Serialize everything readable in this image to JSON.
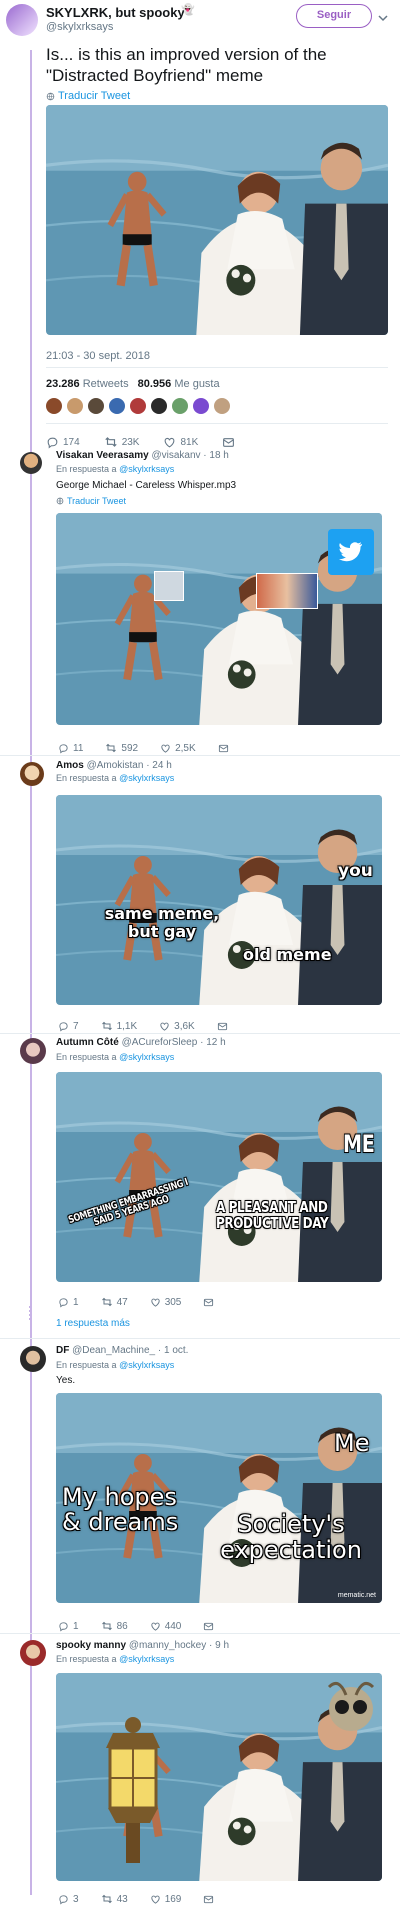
{
  "main_tweet": {
    "name": "SKYLXRK, but spooky",
    "handle": "@skylxrksays",
    "follow_label": "Seguir",
    "text": "Is... is this an improved version of the \"Distracted Boyfriend\" meme",
    "translate": "Traducir Tweet",
    "timestamp": "21:03 - 30 sept. 2018",
    "retweets": "23.286",
    "retweets_label": "Retweets",
    "likes": "80.956",
    "likes_label": "Me gusta",
    "replies_count": "174",
    "rt_count": "23K",
    "like_count": "81K"
  },
  "replies": [
    {
      "name": "Visakan Veerasamy",
      "handle": "@visakanv · 18 h",
      "reply_prefix": "En respuesta a",
      "reply_to": "@skylxrksays",
      "text": "George Michael - Careless Whisper.mp3",
      "translate": "Traducir Tweet",
      "counts": [
        "11",
        "592",
        "2,5K"
      ]
    },
    {
      "name": "Amos",
      "handle": "@Amokistan · 24 h",
      "reply_prefix": "En respuesta a",
      "reply_to": "@skylxrksays",
      "captions": [
        "you",
        "same meme, but gay",
        "old meme"
      ],
      "counts": [
        "7",
        "1,1K",
        "3,6K"
      ]
    },
    {
      "name": "Autumn Côté",
      "handle": "@ACureforSleep · 12 h",
      "reply_prefix": "En respuesta a",
      "reply_to": "@skylxrksays",
      "captions": [
        "ME",
        "SOMETHING EMBARRASSING I SAID 5 YEARS AGO",
        "A PLEASANT AND PRODUCTIVE DAY"
      ],
      "counts": [
        "1",
        "47",
        "305"
      ],
      "more_replies": "1 respuesta más"
    },
    {
      "name": "DF",
      "handle": "@Dean_Machine_ · 1 oct.",
      "reply_prefix": "En respuesta a",
      "reply_to": "@skylxrksays",
      "text": "Yes.",
      "captions": [
        "Me",
        "My hopes & dreams",
        "Society's expectation"
      ],
      "watermark": "mematic.net",
      "counts": [
        "1",
        "86",
        "440"
      ]
    },
    {
      "name": "spooky manny",
      "handle": "@manny_hockey · 9 h",
      "reply_prefix": "En respuesta a",
      "reply_to": "@skylxrksays",
      "counts": [
        "3",
        "43",
        "169"
      ]
    }
  ],
  "colors": {
    "accent": "#1da1f2",
    "thread": "#c8b3e6",
    "follow_border": "#9a5fc4"
  }
}
